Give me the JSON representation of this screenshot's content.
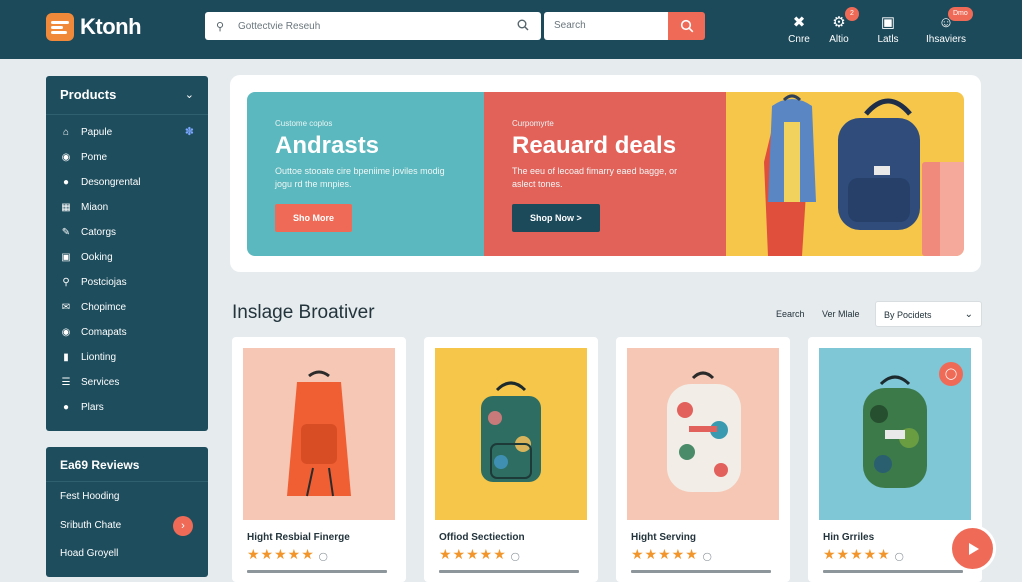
{
  "brand": {
    "name": "Ktonh"
  },
  "search": {
    "placeholder": "Gottectvie Reseuh",
    "secondary": "Search"
  },
  "nav": [
    {
      "label": "Cnre",
      "icon": "tools-icon"
    },
    {
      "label": "Altio",
      "icon": "gear-icon",
      "badge": "2"
    },
    {
      "label": "Latls",
      "icon": "monitor-icon"
    },
    {
      "label": "Ihsaviers",
      "icon": "user-icon",
      "badge": "Dmo"
    }
  ],
  "sidebar": {
    "title": "Products",
    "items": [
      {
        "label": "Papule",
        "icon": "home-icon"
      },
      {
        "label": "Pome",
        "icon": "tag-icon"
      },
      {
        "label": "Desongrental",
        "icon": "person-icon"
      },
      {
        "label": "Miaon",
        "icon": "grid-icon"
      },
      {
        "label": "Catorgs",
        "icon": "wrench-icon"
      },
      {
        "label": "Ooking",
        "icon": "chat-icon"
      },
      {
        "label": "Postciojas",
        "icon": "search-icon"
      },
      {
        "label": "Chopimce",
        "icon": "mail-icon"
      },
      {
        "label": "Comapats",
        "icon": "bubble-icon"
      },
      {
        "label": "Lionting",
        "icon": "chart-icon"
      },
      {
        "label": "Services",
        "icon": "list-icon"
      },
      {
        "label": "Plars",
        "icon": "circle-icon"
      }
    ]
  },
  "reviews": {
    "title": "Ea69 Reviews",
    "items": [
      "Fest Hooding",
      "Sributh Chate",
      "Hoad Groyell"
    ]
  },
  "hero": {
    "panels": [
      {
        "eyebrow": "Custome coplos",
        "title": "Andrasts",
        "desc": "Outtoe stooate cire bpeniime joviles modig jogu rd the mnpies.",
        "button": "Sho More"
      },
      {
        "eyebrow": "Curpomyrte",
        "title": "Reauard deals",
        "desc": "The eeu of lecoad fimarry eaed bagge, or aslect tones.",
        "button": "Shop Now >"
      }
    ]
  },
  "section": {
    "title": "Inslage Broativer",
    "sort_a": "Eearch",
    "sort_b": "Ver Mlale",
    "select": "By Pocidets"
  },
  "products": [
    {
      "name": "Hight Resbial Finerge",
      "rating": 5
    },
    {
      "name": "Offiod Sectiection",
      "rating": 5
    },
    {
      "name": "Hight Serving",
      "rating": 5
    },
    {
      "name": "Hin Grriles",
      "rating": 5
    }
  ],
  "colors": {
    "primary": "#1c4a5a",
    "accent": "#ef6b57",
    "teal": "#5ab8be",
    "coral": "#e2625a",
    "yellow": "#f6c64a"
  }
}
